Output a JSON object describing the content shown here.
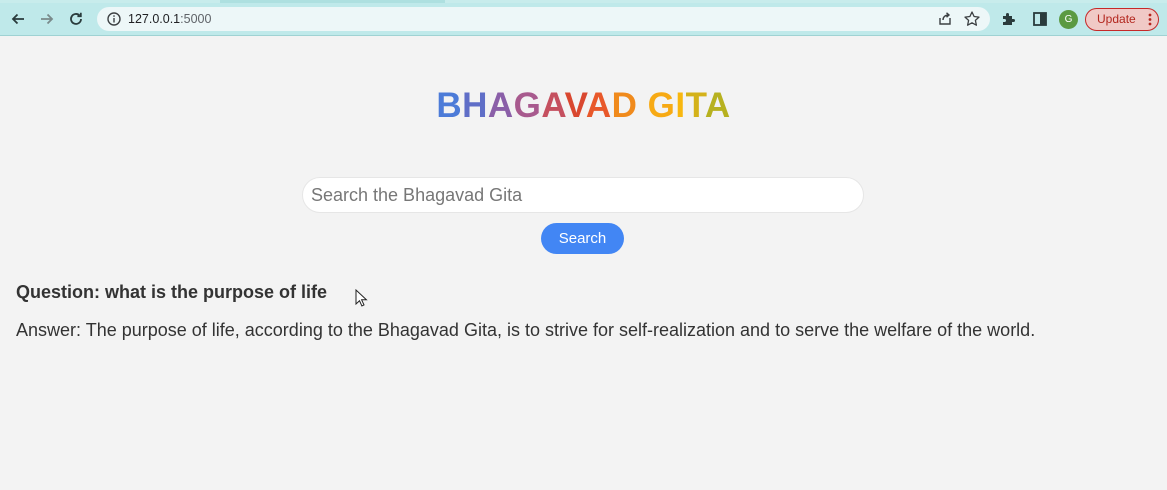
{
  "browser": {
    "url_host": "127.0.0.1",
    "url_port": ":5000",
    "avatar_letter": "G",
    "update_label": "Update"
  },
  "page": {
    "title": "BHAGAVAD GITA",
    "title_colors": [
      "#4c7bd8",
      "#5f6ec7",
      "#8a5fa8",
      "#a85a8e",
      "#c5505f",
      "#d9472f",
      "#e8582a",
      "#f08a1c",
      "#f7aa14",
      "#f8b70f",
      "#d4b21a",
      "#b7b11f",
      "#8fb02a",
      "#64ad33",
      "#3fa845"
    ],
    "search": {
      "placeholder": "Search the Bhagavad Gita",
      "value": "",
      "button_label": "Search"
    },
    "question": "Question: what is the purpose of life",
    "answer": "Answer: The purpose of life, according to the Bhagavad Gita, is to strive for self-realization and to serve the welfare of the world."
  },
  "colors": {
    "toolbar": "#bfe9ea",
    "urlbar": "#edf7f8",
    "search_button": "#4286f4",
    "page_bg": "#f3f3f3"
  }
}
